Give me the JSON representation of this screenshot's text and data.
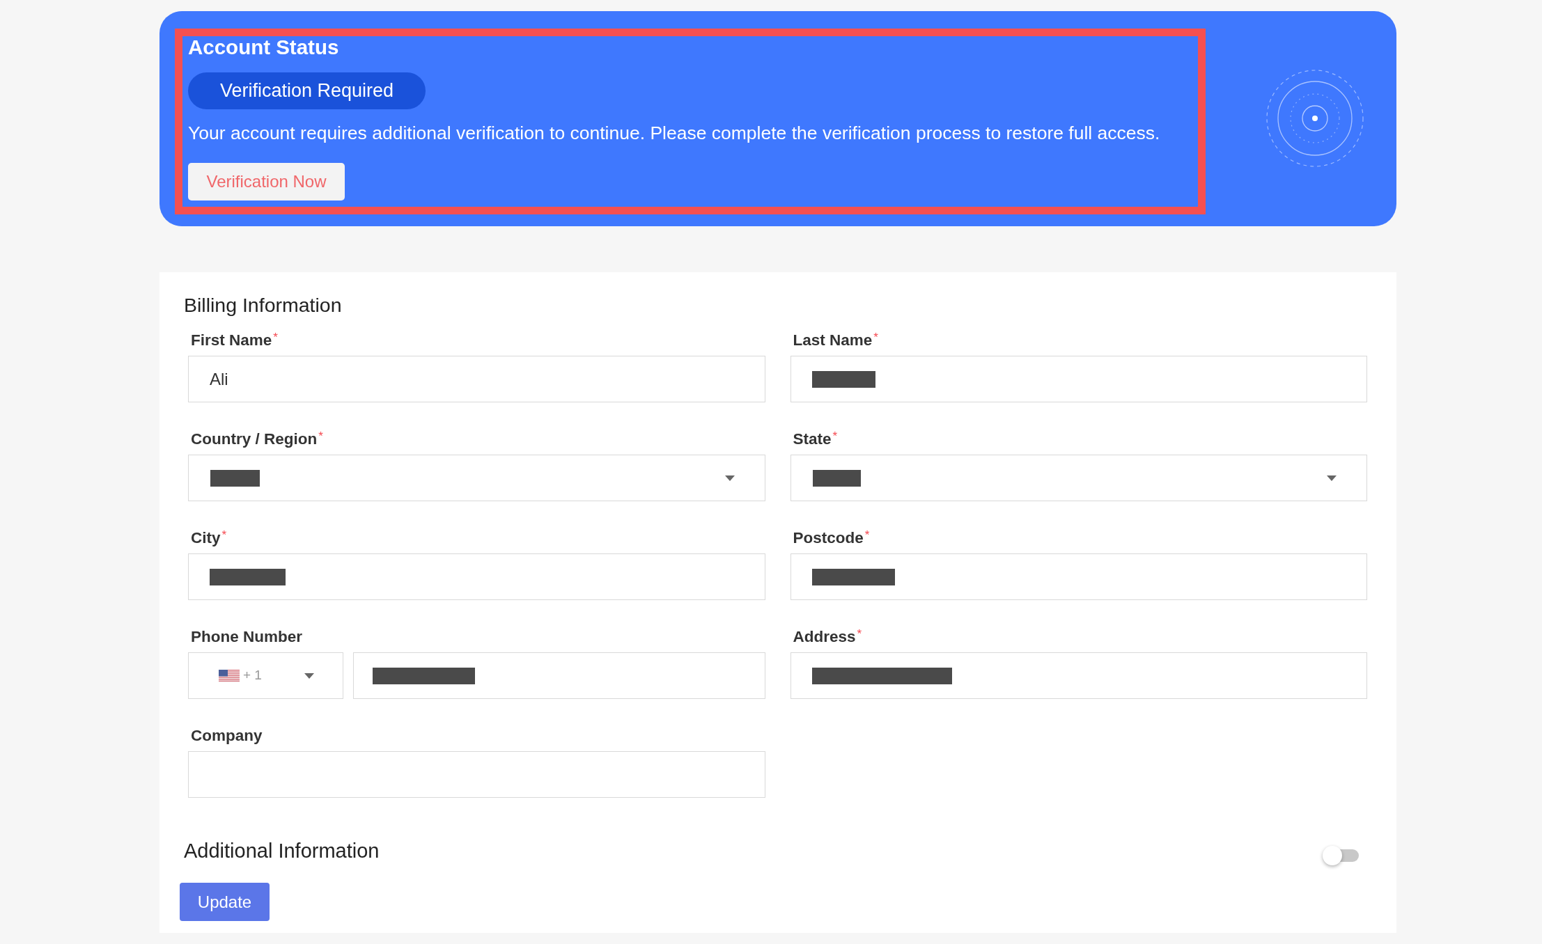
{
  "account_status": {
    "title": "Account Status",
    "highlighted": true,
    "badge": "Verification Required",
    "message": "Your account requires additional verification to continue. Please complete the verification process to restore full access.",
    "button": "Verification Now"
  },
  "billing": {
    "title": "Billing Information",
    "fields": [
      {
        "label": "First Name",
        "required_mark": "*",
        "kind": "text",
        "value": "Ali",
        "redacted": false
      },
      {
        "label": "Last Name",
        "required_mark": "*",
        "kind": "text",
        "redacted": true
      },
      {
        "label": "Country / Region",
        "required_mark": "*",
        "kind": "select",
        "redacted": true
      },
      {
        "label": "State",
        "required_mark": "*",
        "kind": "select",
        "redacted": true
      },
      {
        "label": "City",
        "required_mark": "*",
        "kind": "text",
        "redacted": true
      },
      {
        "label": "Postcode",
        "required_mark": "*",
        "kind": "text",
        "redacted": true
      },
      {
        "label": "Phone Number",
        "kind": "phone",
        "dial_code": "+ 1",
        "redacted": true
      },
      {
        "label": "Address",
        "required_mark": "*",
        "kind": "text",
        "redacted": true
      },
      {
        "label": "Company",
        "kind": "text",
        "redacted": false
      }
    ]
  },
  "additional": {
    "title": "Additional Information",
    "on": false
  },
  "update_button": {
    "label": "Update"
  }
}
